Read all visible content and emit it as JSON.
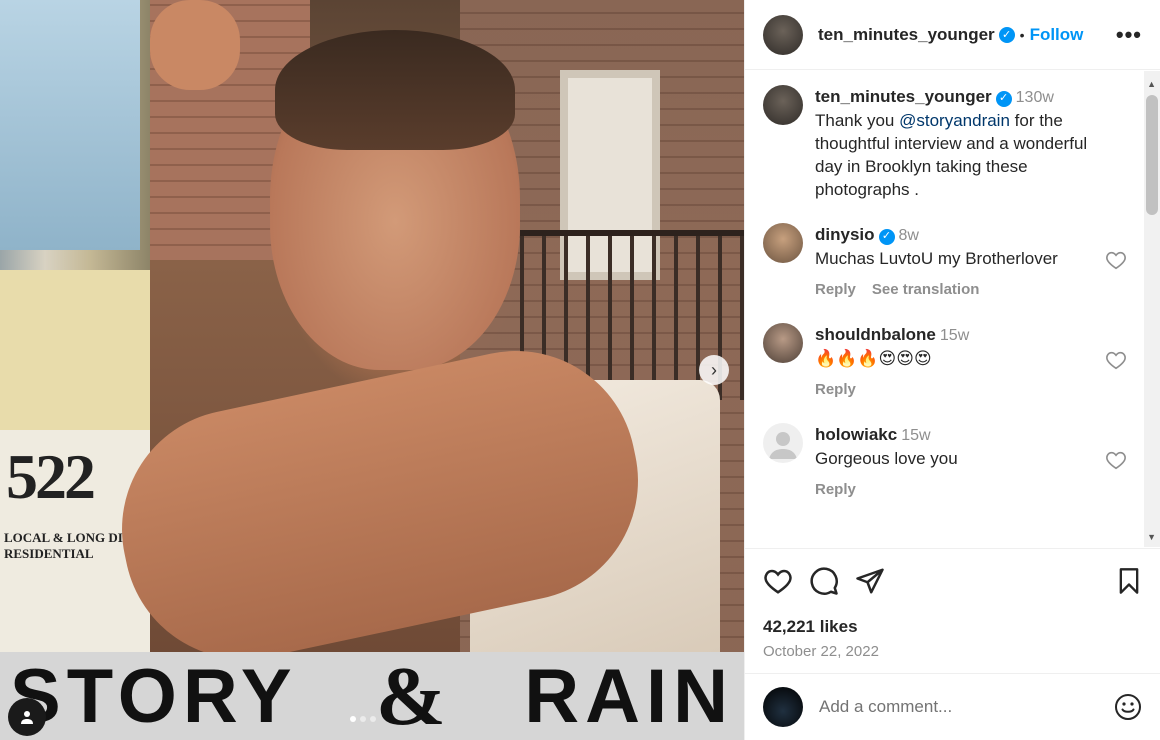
{
  "header": {
    "username": "ten_minutes_younger",
    "separator": "•",
    "follow_label": "Follow",
    "more_label": "•••"
  },
  "media": {
    "next_label": "›",
    "logo_left": "STORY",
    "logo_amp": "&",
    "logo_right": "RAIN",
    "poster_number": "522",
    "poster_text": "LOCAL & LONG DIST RESIDENTIAL",
    "carousel_dots": 3
  },
  "caption": {
    "username": "ten_minutes_younger",
    "time": "130w",
    "text_before": "Thank you ",
    "mention": "@storyandrain",
    "text_after": " for the thoughtful interview and a wonderful day in Brooklyn taking these photographs ."
  },
  "comments": [
    {
      "username": "dinysio",
      "verified": true,
      "time": "8w",
      "text": "Muchas LuvtoU my Brotherlover",
      "reply": "Reply",
      "translate": "See translation",
      "avatar_color": "#9a7b5e"
    },
    {
      "username": "shouldnbalone",
      "verified": false,
      "time": "15w",
      "text": "🔥🔥🔥😍😍😍",
      "reply": "Reply",
      "avatar_color": "#7a6a5a"
    },
    {
      "username": "holowiakc",
      "verified": false,
      "time": "15w",
      "text": "Gorgeous love you",
      "reply": "Reply",
      "avatar_color": "#dbdbdb"
    }
  ],
  "footer": {
    "likes": "42,221 likes",
    "date": "October 22, 2022",
    "add_placeholder": "Add a comment..."
  },
  "colors": {
    "accent": "#0095f6",
    "secondary_text": "#8e8e8e",
    "primary_text": "#262626"
  }
}
